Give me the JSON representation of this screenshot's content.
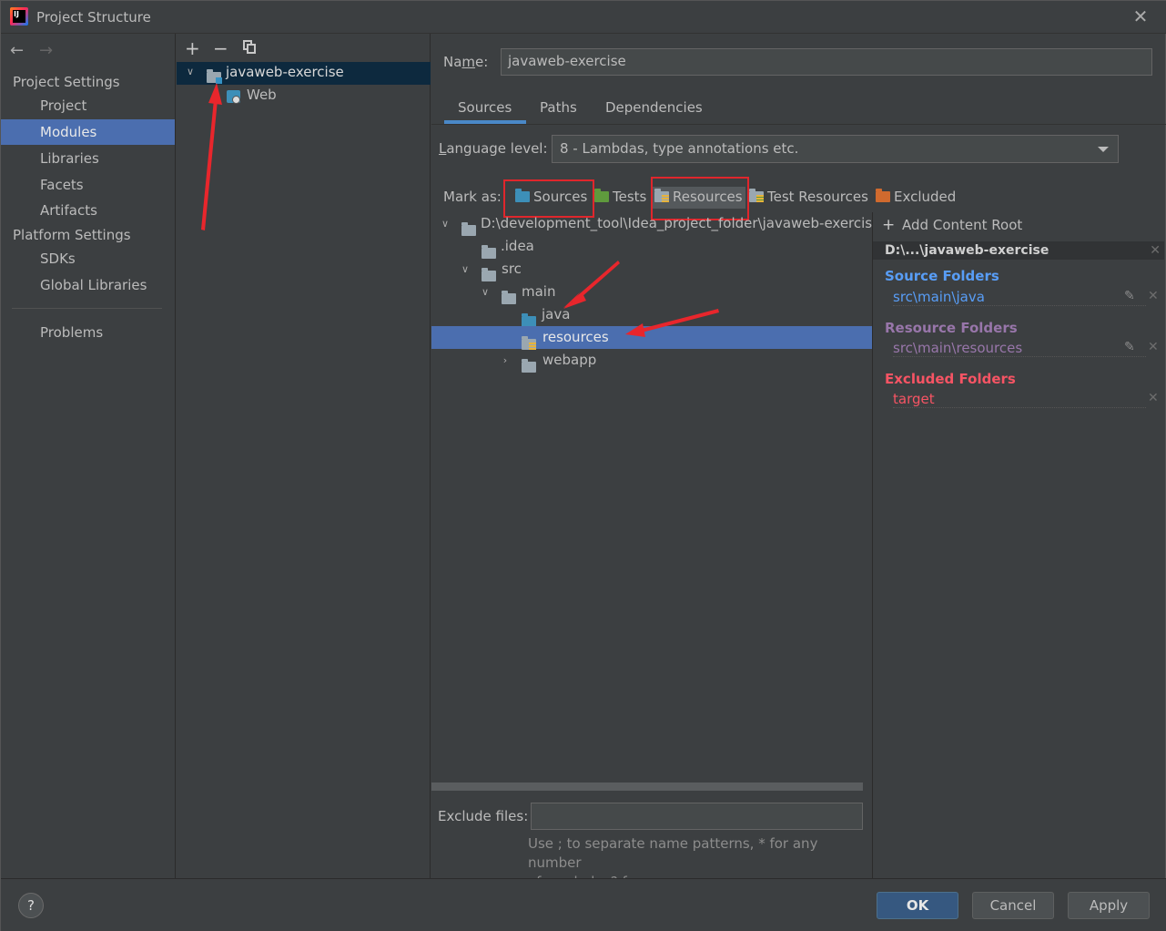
{
  "window": {
    "title": "Project Structure"
  },
  "nav": {
    "project_settings_label": "Project Settings",
    "platform_settings_label": "Platform Settings",
    "items": [
      "Project",
      "Modules",
      "Libraries",
      "Facets",
      "Artifacts"
    ],
    "platform_items": [
      "SDKs",
      "Global Libraries"
    ],
    "problems": "Problems",
    "selected": "Modules"
  },
  "modules": {
    "module_name": "javaweb-exercise",
    "facet": "Web"
  },
  "details": {
    "name_label": "Name:",
    "name_value": "javaweb-exercise",
    "tabs": [
      "Sources",
      "Paths",
      "Dependencies"
    ],
    "active_tab": "Sources",
    "language_label": "Language level:",
    "language_value": "8 - Lambdas, type annotations etc.",
    "mark_as_label": "Mark as:",
    "mark_as": {
      "sources": "Sources",
      "tests": "Tests",
      "resources": "Resources",
      "test_resources": "Test Resources",
      "excluded": "Excluded"
    },
    "tree": {
      "root": "D:\\development_tool\\Idea_project_folder\\javaweb-exercise",
      "idea": ".idea",
      "src": "src",
      "main": "main",
      "java": "java",
      "resources": "resources",
      "webapp": "webapp"
    },
    "exclude_label": "Exclude files:",
    "hint_line1": "Use ; to separate name patterns, * for any number",
    "hint_line2": "of symbols, ? for one."
  },
  "roots": {
    "add_label": "Add Content Root",
    "root_path": "D:\\...\\javaweb-exercise",
    "source_title": "Source Folders",
    "source_path": "src\\main\\java",
    "resource_title": "Resource Folders",
    "resource_path": "src\\main\\resources",
    "excluded_title": "Excluded Folders",
    "excluded_path": "target"
  },
  "buttons": {
    "help": "?",
    "ok": "OK",
    "cancel": "Cancel",
    "apply": "Apply"
  },
  "colors": {
    "selection": "#4b6eaf",
    "source_blue": "#589df6",
    "resource_purple": "#9876aa",
    "excluded_red": "#f75464",
    "annotation_red": "#e0262c",
    "primary_button": "#365880"
  }
}
